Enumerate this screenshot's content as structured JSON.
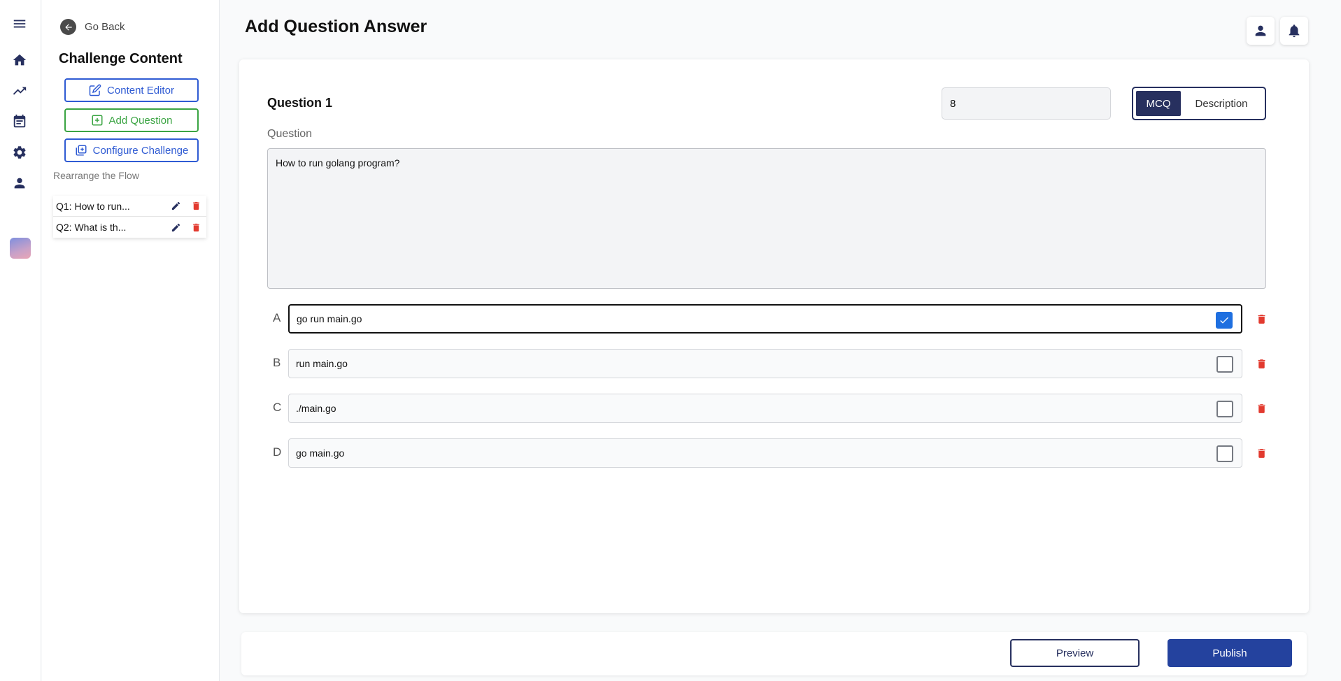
{
  "rail": {
    "items": [
      {
        "icon": "menu-icon"
      },
      {
        "icon": "home-icon"
      },
      {
        "icon": "trending-icon"
      },
      {
        "icon": "calendar-icon"
      },
      {
        "icon": "gear-icon"
      },
      {
        "icon": "person-icon"
      }
    ]
  },
  "sidebar": {
    "go_back": "Go Back",
    "heading": "Challenge Content",
    "content_editor": "Content Editor",
    "add_question": "Add Question",
    "configure_challenge": "Configure Challenge",
    "rearrange_label": "Rearrange the Flow",
    "questions": [
      {
        "label": "Q1: How to run..."
      },
      {
        "label": "Q2: What is th..."
      }
    ]
  },
  "page": {
    "title": "Add Question Answer"
  },
  "editor": {
    "question_title": "Question 1",
    "points_value": "8",
    "type_options": [
      "MCQ",
      "Description"
    ],
    "selected_type": "MCQ",
    "question_label": "Question",
    "question_text": "How to run golang program?",
    "answers": [
      {
        "letter": "A",
        "text": "go run main.go",
        "correct": true
      },
      {
        "letter": "B",
        "text": "run main.go",
        "correct": false
      },
      {
        "letter": "C",
        "text": "./main.go",
        "correct": false
      },
      {
        "letter": "D",
        "text": "go main.go",
        "correct": false
      }
    ]
  },
  "footer": {
    "preview": "Preview",
    "publish": "Publish"
  },
  "colors": {
    "navy": "#27305f",
    "primary_blue": "#2f5bd3",
    "green": "#3aa442",
    "danger": "#e23a2f",
    "checkbox_blue": "#1e6fe0",
    "publish_blue": "#24429e"
  }
}
